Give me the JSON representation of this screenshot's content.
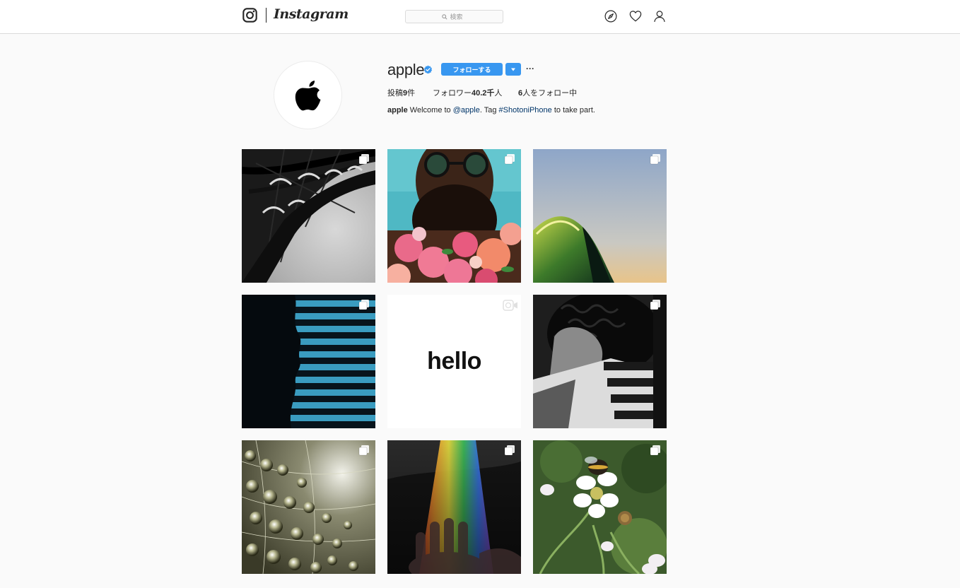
{
  "header": {
    "wordmark": "Instagram",
    "search": {
      "placeholder": "検索"
    }
  },
  "profile": {
    "username": "apple",
    "verified": true,
    "follow_label": "フォローする",
    "more_label": "···",
    "stats": {
      "posts_prefix": "投稿",
      "posts_value": "9",
      "posts_suffix": "件",
      "followers_prefix": "フォロワー",
      "followers_value": "40.2千",
      "followers_suffix": "人",
      "following_value": "6",
      "following_suffix": "人をフォロー中"
    },
    "bio": {
      "name": "apple",
      "text_1": " Welcome to ",
      "mention": "@apple",
      "text_2": ". Tag ",
      "hashtag": "#ShotoniPhone",
      "text_3": " to take part."
    }
  },
  "posts": [
    {
      "subject": "eiffel-tower",
      "type": "carousel"
    },
    {
      "subject": "man-with-roses",
      "type": "carousel"
    },
    {
      "subject": "wave",
      "type": "carousel"
    },
    {
      "subject": "silhouette-blinds",
      "type": "carousel"
    },
    {
      "subject": "hello",
      "type": "video",
      "text": "hello"
    },
    {
      "subject": "woman-shadows",
      "type": "carousel"
    },
    {
      "subject": "water-droplets",
      "type": "carousel"
    },
    {
      "subject": "rainbow-hand",
      "type": "carousel"
    },
    {
      "subject": "bee-on-blossom",
      "type": "carousel"
    }
  ],
  "colors": {
    "accent": "#3897f0",
    "link": "#003569",
    "border": "#dbdbdb",
    "background": "#fafafa"
  }
}
